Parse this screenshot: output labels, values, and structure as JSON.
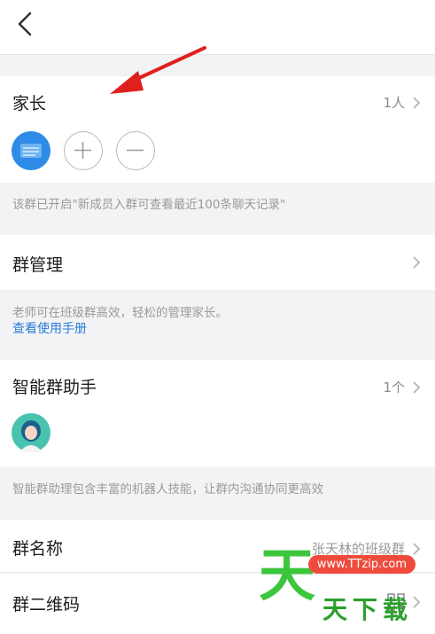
{
  "header": {
    "back_icon": "chevron-left-icon"
  },
  "parents": {
    "title": "家长",
    "count": "1人",
    "note": "该群已开启\"新成员入群可查看最近100条聊天记录\""
  },
  "group_manage": {
    "title": "群管理",
    "note": "老师可在班级群高效，轻松的管理家长。",
    "link": "查看使用手册"
  },
  "assistant": {
    "title": "智能群助手",
    "count": "1个",
    "note": "智能群助理包含丰富的机器人技能，让群内沟通协同更高效"
  },
  "group_name": {
    "title": "群名称",
    "value": "张天林的班级群"
  },
  "qr_code": {
    "title": "群二维码"
  },
  "watermark": {
    "url": "www.TTzip.com",
    "big": "天",
    "small": "天下载"
  },
  "colors": {
    "link": "#2a7bd8",
    "accent_blue": "#2e8be8",
    "arrow": "#e0201f",
    "watermark_green": "#3dc63c"
  }
}
